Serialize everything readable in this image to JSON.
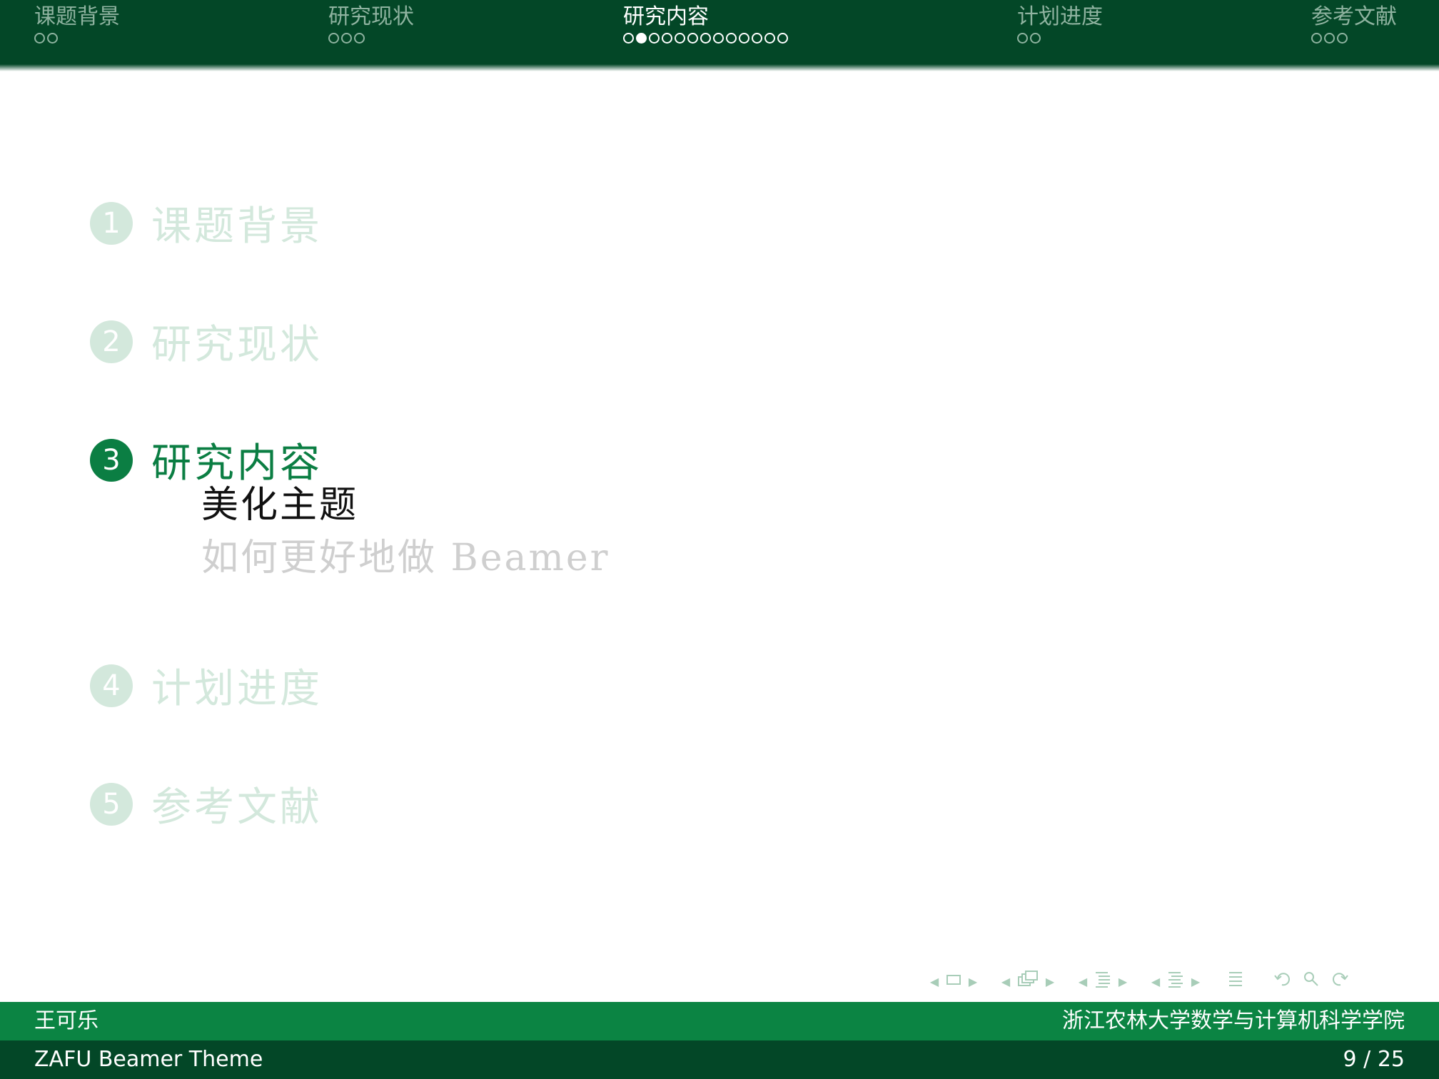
{
  "header": {
    "sections": [
      {
        "title": "课题背景",
        "dots": 2,
        "active": false,
        "current_dot": null
      },
      {
        "title": "研究现状",
        "dots": 3,
        "active": false,
        "current_dot": null
      },
      {
        "title": "研究内容",
        "dots": 13,
        "active": true,
        "current_dot": 1
      },
      {
        "title": "计划进度",
        "dots": 2,
        "active": false,
        "current_dot": null
      },
      {
        "title": "参考文献",
        "dots": 3,
        "active": false,
        "current_dot": null
      }
    ]
  },
  "outline": {
    "items": [
      {
        "number": "1",
        "label": "课题背景",
        "active": false
      },
      {
        "number": "2",
        "label": "研究现状",
        "active": false
      },
      {
        "number": "3",
        "label": "研究内容",
        "active": true
      },
      {
        "number": "4",
        "label": "计划进度",
        "active": false
      },
      {
        "number": "5",
        "label": "参考文献",
        "active": false
      }
    ],
    "subitems": [
      {
        "label": "美化主题",
        "current": true
      },
      {
        "label": "如何更好地做 Beamer",
        "current": false
      }
    ]
  },
  "nav_symbols": {
    "icons": [
      "frame-icon",
      "subsection-icon",
      "section-icon",
      "presentation-icon",
      "outline-icon",
      "undo-icon",
      "search-icon",
      "redo-icon"
    ]
  },
  "footer": {
    "author": "王可乐",
    "institute": "浙江农林大学数学与计算机科学学院",
    "title": "ZAFU Beamer Theme",
    "page_current": "9",
    "page_separator": "/",
    "page_total": "25"
  },
  "colors": {
    "header_bg": "#034727",
    "accent": "#0b7e43",
    "footer_top": "#0b8443",
    "dim_green": "#d3e8dc"
  }
}
